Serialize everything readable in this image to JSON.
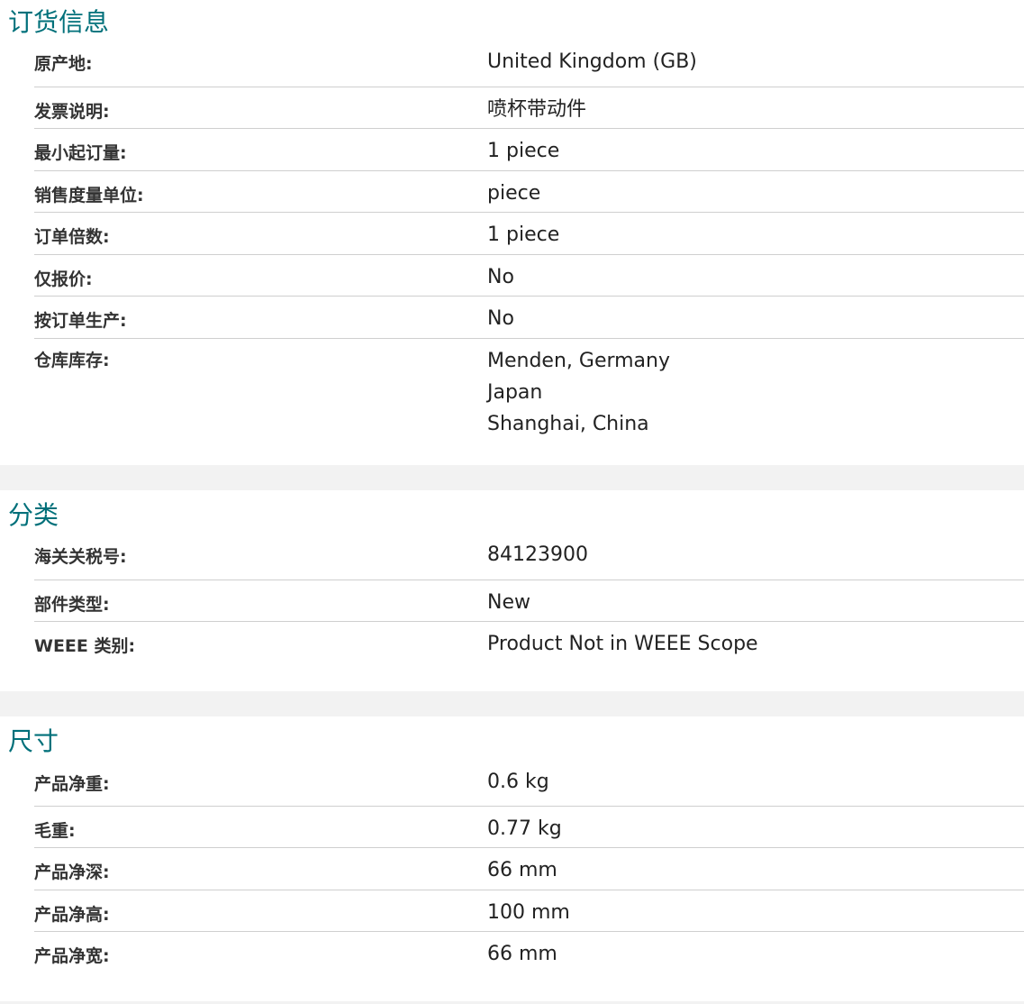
{
  "ordering": {
    "title": "订货信息",
    "rows": [
      {
        "label": "原产地:",
        "value": "United Kingdom (GB)"
      },
      {
        "label": "发票说明:",
        "value": "喷杯带动件"
      },
      {
        "label": "最小起订量:",
        "value": "1 piece"
      },
      {
        "label": "销售度量单位:",
        "value": "piece"
      },
      {
        "label": "订单倍数:",
        "value": "1 piece"
      },
      {
        "label": "仅报价:",
        "value": "No"
      },
      {
        "label": "按订单生产:",
        "value": "No"
      },
      {
        "label": "仓库库存:",
        "values": [
          "Menden, Germany",
          "Japan",
          "Shanghai, China"
        ]
      }
    ]
  },
  "classification": {
    "title": "分类",
    "rows": [
      {
        "label": "海关关税号:",
        "value": "84123900"
      },
      {
        "label": "部件类型:",
        "value": "New"
      },
      {
        "label": "WEEE 类别:",
        "value": "Product Not in WEEE Scope"
      }
    ]
  },
  "dimensions": {
    "title": "尺寸",
    "rows": [
      {
        "label": "产品净重:",
        "value": "0.6 kg"
      },
      {
        "label": "毛重:",
        "value": "0.77 kg"
      },
      {
        "label": "产品净深:",
        "value": "66 mm"
      },
      {
        "label": "产品净高:",
        "value": "100 mm"
      },
      {
        "label": "产品净宽:",
        "value": "66 mm"
      }
    ]
  },
  "colors": {
    "title": "#00707a",
    "divider": "#cfcfcf",
    "gap": "#f2f2f2"
  }
}
